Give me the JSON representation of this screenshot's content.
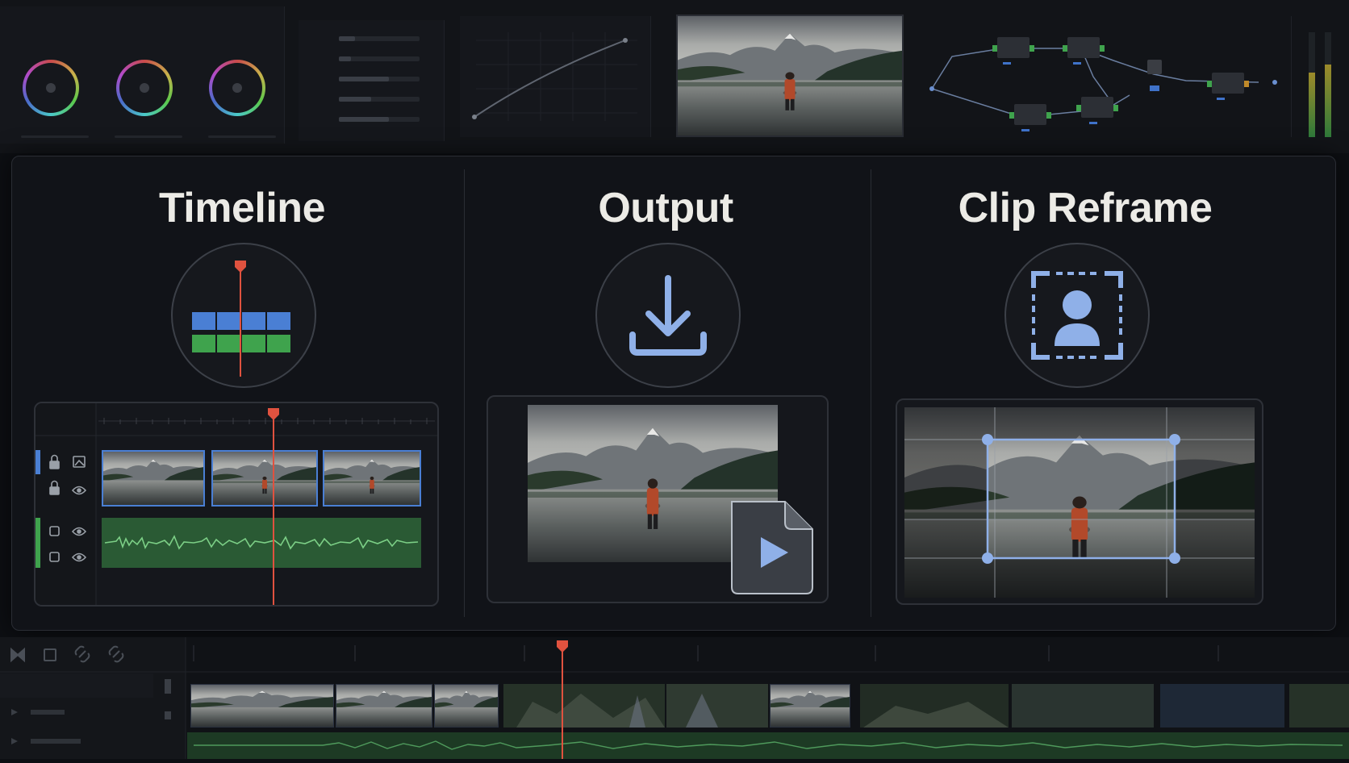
{
  "features": {
    "timeline": {
      "title": "Timeline"
    },
    "output": {
      "title": "Output"
    },
    "reframe": {
      "title": "Clip Reframe"
    }
  },
  "colors": {
    "accent_blue": "#4a7fd4",
    "accent_green": "#3fa34d",
    "playhead_red": "#e0523f",
    "panel_bg": "#111318",
    "frame_blue": "#8fb0e8"
  },
  "icons": {
    "timeline": "timeline-icon",
    "output": "download-icon",
    "reframe": "reframe-person-icon",
    "play_file": "play-file-icon"
  }
}
